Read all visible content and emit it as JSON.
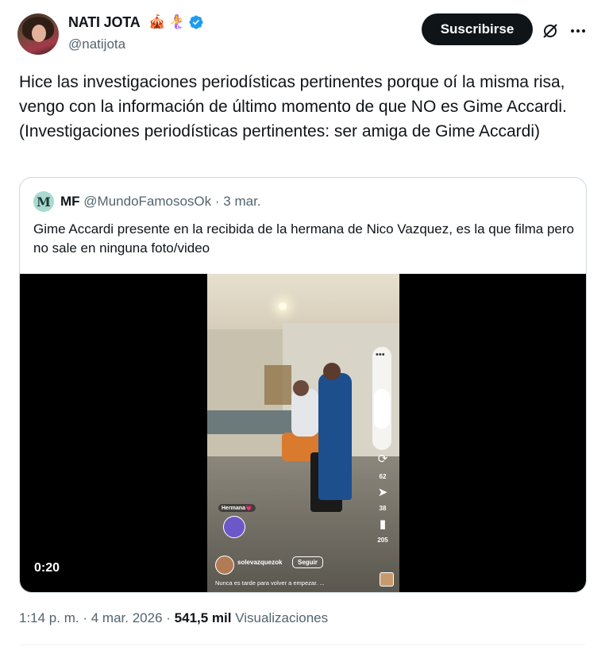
{
  "author": {
    "display_name": "NATI JOTA",
    "emojis": [
      "🎪",
      "🧜‍♀️"
    ],
    "verified_icon": "verified-badge-icon",
    "handle": "@natijota"
  },
  "header_actions": {
    "subscribe_label": "Suscribirse",
    "grok_icon": "grok-icon",
    "more_icon": "more-options-icon"
  },
  "tweet": {
    "text": "Hice las investigaciones periodísticas pertinentes porque oí la misma risa, vengo con la información de último momento de que NO es Gime Accardi. (Investigaciones periodísticas pertinentes: ser amiga de Gime Accardi)"
  },
  "quoted": {
    "avatar_letter": "M",
    "name": "MF",
    "handle": "@MundoFamososOk",
    "separator": "·",
    "date": "3 mar.",
    "text": "Gime Accardi presente en la recibida de la hermana de Nico Vazquez, es la que filma pero no sale en ninguna foto/video",
    "video": {
      "duration": "0:20",
      "overlay": {
        "dots": "•••",
        "repost_count": "62",
        "share_count": "38",
        "save_count": "205",
        "sticker_label": "Hermana💗",
        "username": "solevazquezok",
        "follow_label": "Seguir",
        "caption": "Nunca es tarde para volver a empezar. ..."
      }
    }
  },
  "footer": {
    "time": "1:14 p. m.",
    "sep1": "·",
    "date": "4 mar. 2026",
    "sep2": "·",
    "views_count": "541,5 mil",
    "views_label": "Visualizaciones"
  },
  "colors": {
    "text_primary": "#0f1419",
    "text_secondary": "#536471",
    "verified_blue": "#1d9bf0",
    "border": "#cfd9de",
    "button_bg": "#0f1419"
  }
}
